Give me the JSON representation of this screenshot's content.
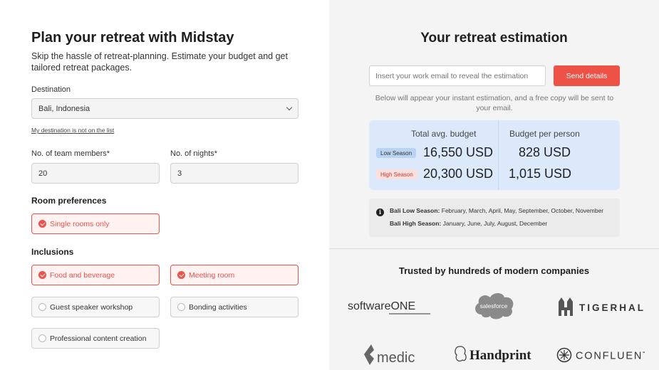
{
  "form": {
    "title": "Plan your retreat with Midstay",
    "subtitle": "Skip the hassle of retreat-planning. Estimate your budget and get tailored retreat packages.",
    "destination_label": "Destination",
    "destination_value": "Bali, Indonesia",
    "destination_link": "My destination is not on the list",
    "members_label": "No. of team members*",
    "members_value": "20",
    "nights_label": "No. of nights*",
    "nights_value": "3",
    "room_title": "Room preferences",
    "room_options": [
      {
        "label": "Single rooms only",
        "selected": true
      }
    ],
    "inclusions_title": "Inclusions",
    "inclusions": [
      {
        "label": "Food and beverage",
        "selected": true
      },
      {
        "label": "Meeting room",
        "selected": true
      },
      {
        "label": "Guest speaker workshop",
        "selected": false
      },
      {
        "label": "Bonding activities",
        "selected": false
      },
      {
        "label": "Professional content creation",
        "selected": false
      }
    ]
  },
  "estimation": {
    "title": "Your retreat estimation",
    "email_placeholder": "Insert your work email to reveal the estimation",
    "send_label": "Send details",
    "note": "Below will appear your instant estimation, and a free copy will be sent to your email.",
    "col_total": "Total avg. budget",
    "col_person": "Budget per person",
    "low_badge": "Low Season",
    "high_badge": "High Season",
    "low_total": "16,550 USD",
    "high_total": "20,300 USD",
    "low_person": "828 USD",
    "high_person": "1,015 USD",
    "low_season_label": "Bali Low Season:",
    "low_season_months": "February, March, April, May, September, October, November",
    "high_season_label": "Bali High Season:",
    "high_season_months": "January, June, July, August, December",
    "info_icon_glyph": "i",
    "accent_color": "#ee5246"
  },
  "trusted": {
    "title": "Trusted by hundreds of modern companies",
    "logos": [
      "softwareONE",
      "salesforce",
      "TIGERHALL",
      "medic",
      "Handprint",
      "CONFLUENT"
    ]
  }
}
